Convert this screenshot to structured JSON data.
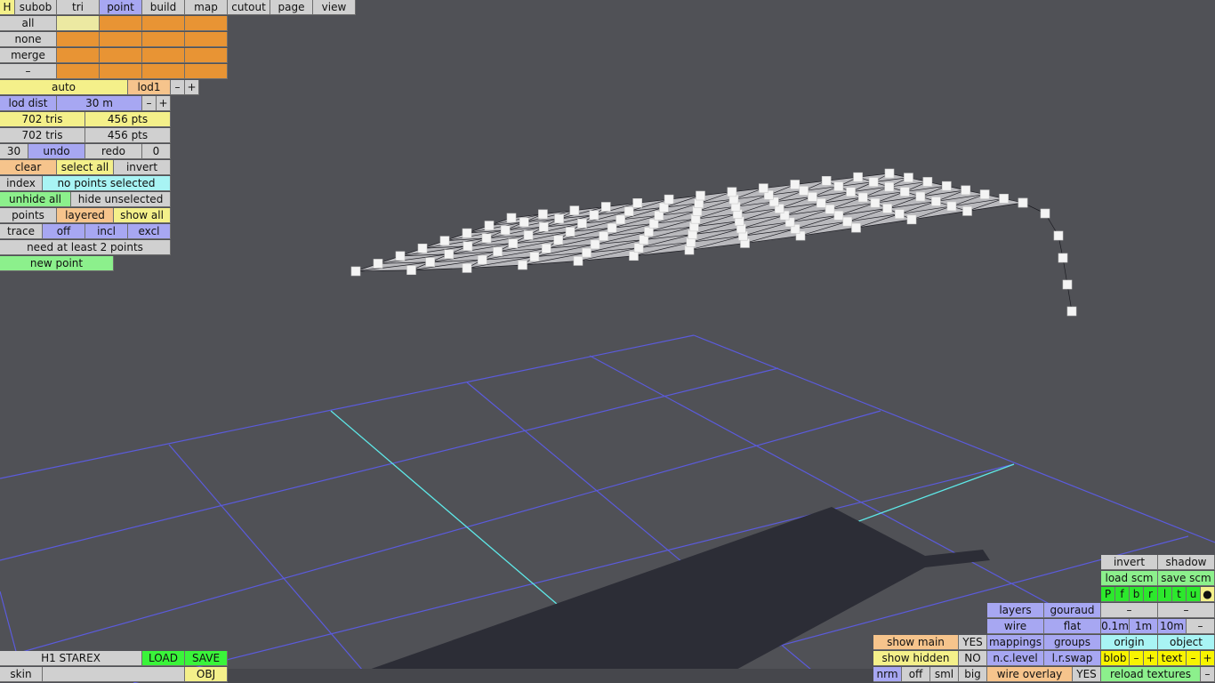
{
  "topbar": {
    "h": "H",
    "tabs": [
      "subob",
      "tri",
      "point",
      "build",
      "map",
      "cutout",
      "page",
      "view"
    ],
    "active_tab": "point"
  },
  "select_rows": {
    "all": "all",
    "none": "none",
    "merge": "merge",
    "dash": "–"
  },
  "lod": {
    "auto": "auto",
    "lod1": "lod1",
    "minus": "–",
    "plus": "+",
    "lod_dist_label": "lod dist",
    "lod_dist_value": "30 m"
  },
  "stats": {
    "tris_a": "702 tris",
    "pts_a": "456 pts",
    "tris_b": "702 tris",
    "pts_b": "456 pts"
  },
  "history": {
    "undo_count": "30",
    "undo": "undo",
    "redo": "redo",
    "redo_count": "0"
  },
  "selection": {
    "clear": "clear",
    "select_all": "select all",
    "invert": "invert",
    "index": "index",
    "status": "no points selected",
    "unhide_all": "unhide all",
    "hide_unselected": "hide unselected",
    "points": "points",
    "layered": "layered",
    "show_all": "show all",
    "trace": "trace",
    "off": "off",
    "incl": "incl",
    "excl": "excl",
    "hint": "need at least 2 points",
    "new_point": "new point"
  },
  "bottom_left": {
    "model_name": "H1 STAREX",
    "load": "LOAD",
    "save": "SAVE",
    "skin": "skin",
    "obj": "OBJ"
  },
  "bottom_right": {
    "invert": "invert",
    "shadow": "shadow",
    "load_scm": "load scm",
    "save_scm": "save scm",
    "flags": [
      "P",
      "f",
      "b",
      "r",
      "l",
      "t",
      "u",
      "●"
    ],
    "dash": "–",
    "layers": "layers",
    "gouraud": "gouraud",
    "wire": "wire",
    "flat": "flat",
    "step_01": "0.1m",
    "step_1": "1m",
    "step_10": "10m",
    "show_main": "show main",
    "yes": "YES",
    "mappings": "mappings",
    "groups": "groups",
    "origin": "origin",
    "object": "object",
    "show_hidden": "show hidden",
    "no": "NO",
    "nc_level": "n.c.level",
    "lr_swap": "l.r.swap",
    "blob": "blob",
    "text": "text",
    "plus": "+",
    "nrm": "nrm",
    "off": "off",
    "sml": "sml",
    "big": "big",
    "wire_overlay": "wire overlay",
    "reload_textures": "reload textures"
  },
  "colors": {
    "background": "#505156",
    "grid": "#5b5bdc",
    "grid_axis": "#5ee8e8",
    "shadow": "#2c2d36",
    "point_marker": "#f4f4f4"
  }
}
